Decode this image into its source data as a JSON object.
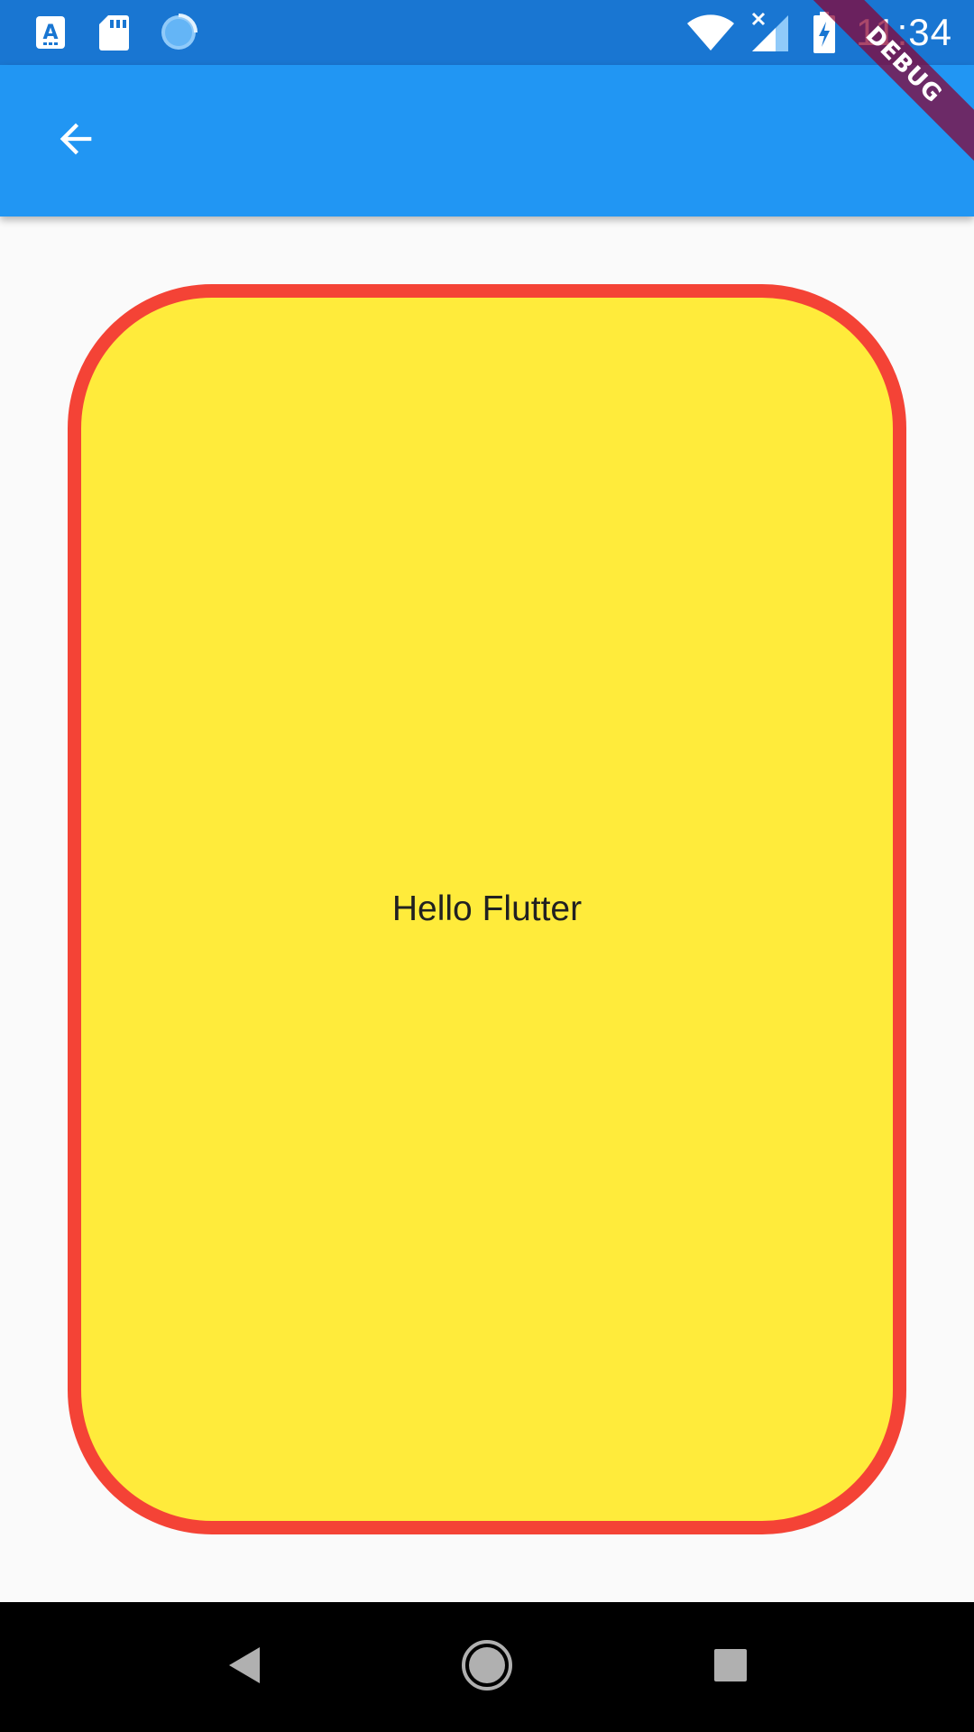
{
  "status_bar": {
    "time": "11:34",
    "icons": {
      "left": [
        "a-notification-icon",
        "sd-card-icon",
        "sync-progress-icon"
      ],
      "right": [
        "wifi-icon",
        "cellular-no-data-icon",
        "battery-charging-icon"
      ]
    },
    "background_color": "#1976d2"
  },
  "app_bar": {
    "background_color": "#2196f3",
    "back_icon": "arrow-back-icon"
  },
  "debug_banner": {
    "label": "DEBUG"
  },
  "card": {
    "text": "Hello Flutter",
    "fill_color": "#ffeb3b",
    "border_color": "#f44336"
  },
  "nav_bar": {
    "buttons": [
      "back-triangle-icon",
      "home-circle-icon",
      "recents-square-icon"
    ]
  }
}
